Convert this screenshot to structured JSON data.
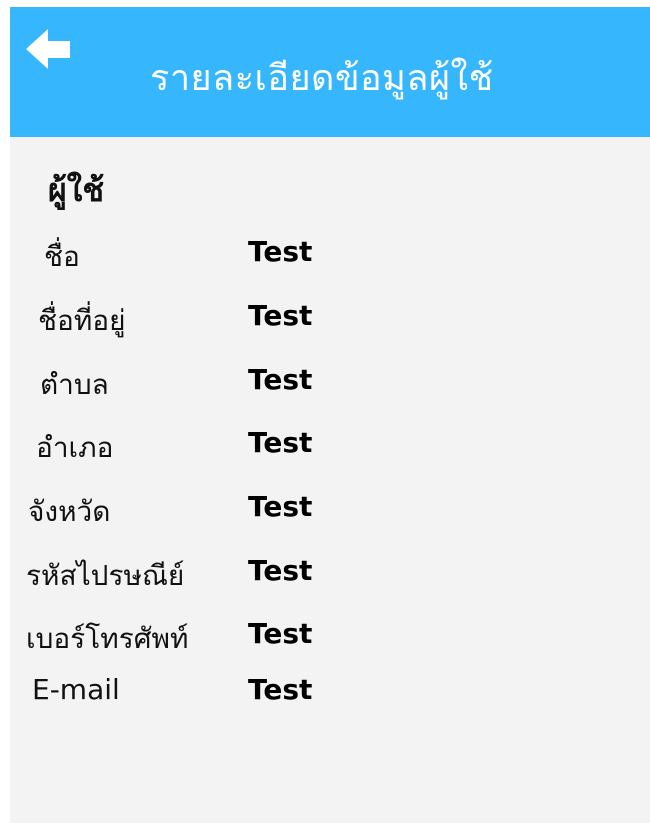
{
  "header": {
    "back_icon": "arrow-left-icon",
    "title": "รายละเอียดข้อมูลผู้ใช้"
  },
  "section": {
    "title": "ผู้ใช้"
  },
  "fields": [
    {
      "label": "ชื่อ",
      "value": "Test"
    },
    {
      "label": "ชื่อที่อยู่",
      "value": "Test"
    },
    {
      "label": "ตำบล",
      "value": "Test"
    },
    {
      "label": "อำเภอ",
      "value": "Test"
    },
    {
      "label": "จังหวัด",
      "value": "Test"
    },
    {
      "label": "รหัสไปรษณีย์",
      "value": "Test"
    },
    {
      "label": "เบอร์โทรศัพท์",
      "value": "Test"
    },
    {
      "label": "E-mail",
      "value": "Test"
    }
  ],
  "colors": {
    "header_background": "#36b6fd",
    "page_background": "#f3f3f3",
    "header_text": "#ffffff"
  }
}
